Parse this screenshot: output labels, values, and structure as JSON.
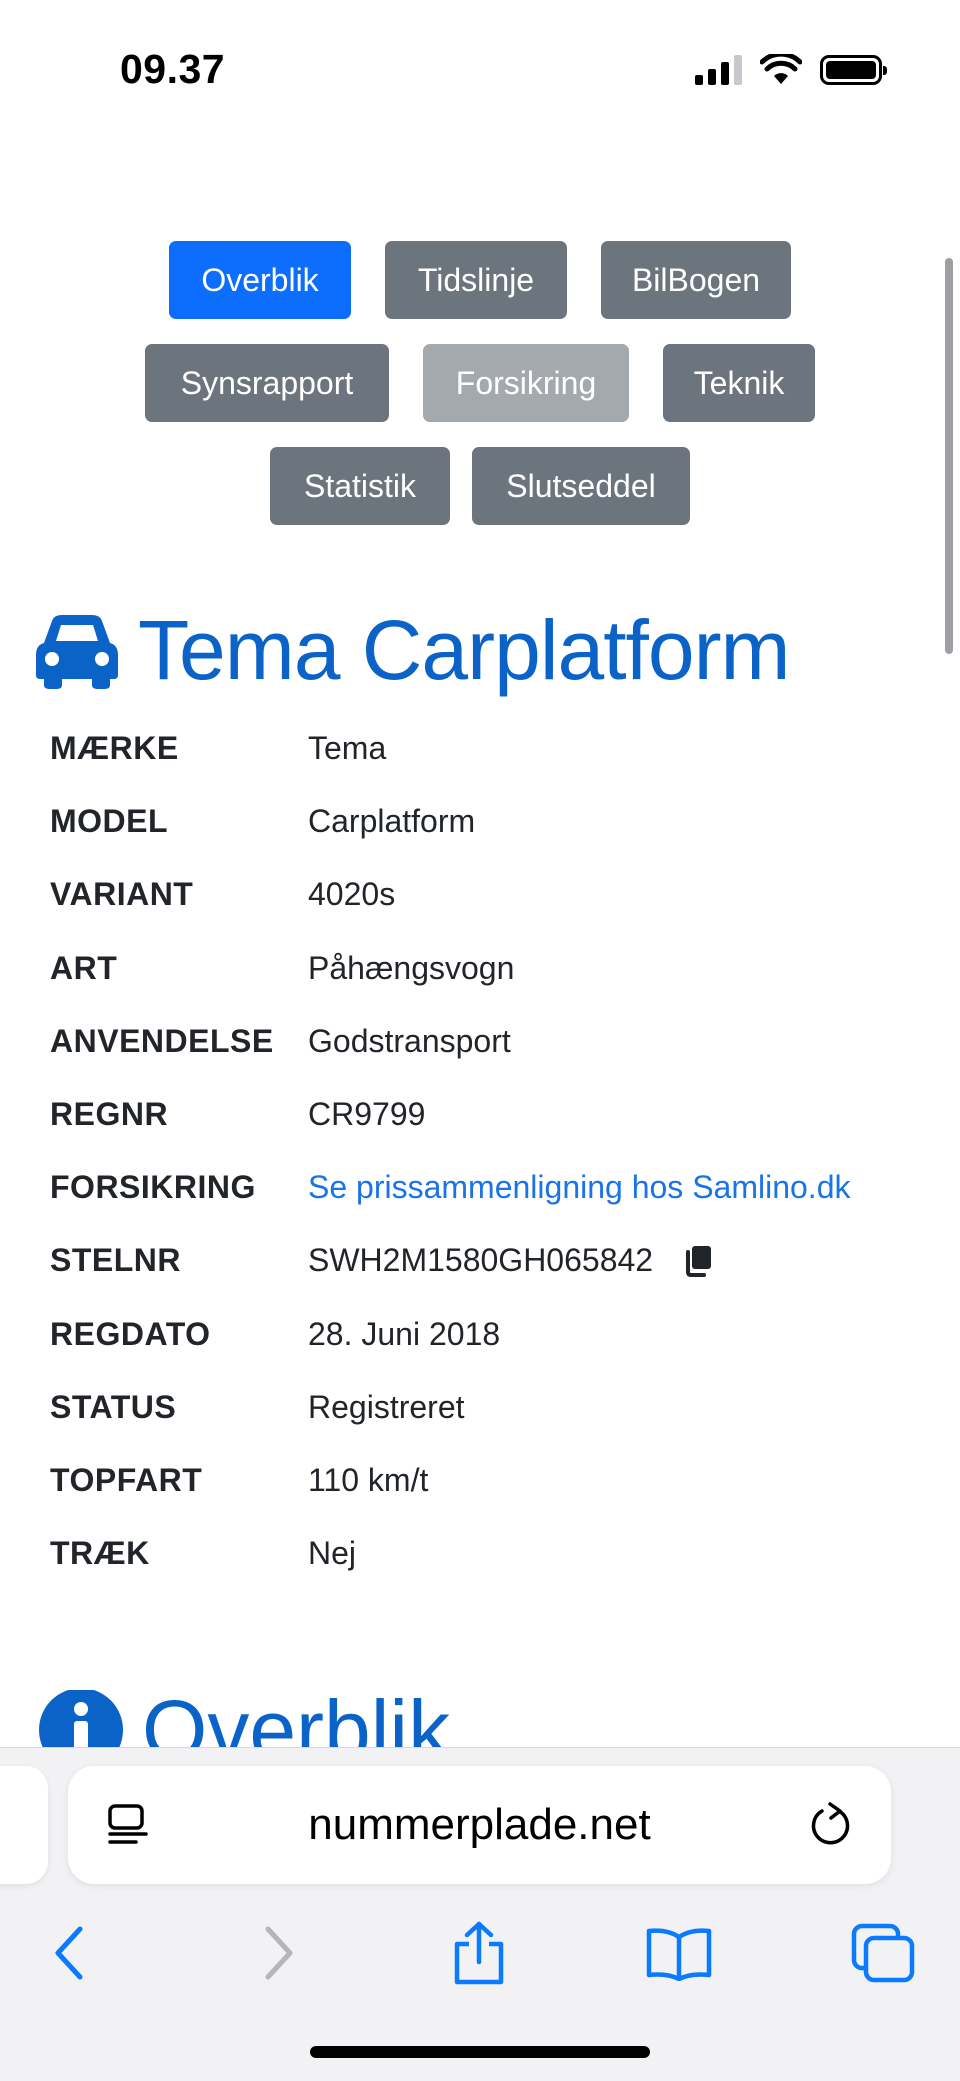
{
  "status_bar": {
    "time": "09.37"
  },
  "nav": {
    "row1": [
      "Overblik",
      "Tidslinje",
      "BilBogen"
    ],
    "row2": [
      "Synsrapport",
      "Forsikring",
      "Teknik"
    ],
    "row3": [
      "Statistik",
      "Slutseddel"
    ]
  },
  "vehicle": {
    "title": "Tema Carplatform",
    "rows": [
      {
        "label": "MÆRKE",
        "value": "Tema"
      },
      {
        "label": "MODEL",
        "value": "Carplatform"
      },
      {
        "label": "VARIANT",
        "value": "4020s"
      },
      {
        "label": "ART",
        "value": "Påhængsvogn"
      },
      {
        "label": "ANVENDELSE",
        "value": "Godstransport"
      },
      {
        "label": "REGNR",
        "value": "CR9799"
      },
      {
        "label": "FORSIKRING",
        "value": "Se prissammenligning hos Samlino.dk"
      },
      {
        "label": "STELNR",
        "value": "SWH2M1580GH065842"
      },
      {
        "label": "REGDATO",
        "value": "28. Juni 2018"
      },
      {
        "label": "STATUS",
        "value": "Registreret"
      },
      {
        "label": "TOPFART",
        "value": "110 km/t"
      },
      {
        "label": "TRÆK",
        "value": "Nej"
      }
    ]
  },
  "section": {
    "title": "Overblik"
  },
  "browser": {
    "url": "nummerplade.net"
  },
  "colors": {
    "primary": "#0d6efd",
    "secondary": "#6c757d",
    "heading": "#0b63c7",
    "link": "#1a73e8",
    "ios_blue": "#0a7aff"
  },
  "icons": {
    "vehicle": "car-icon",
    "section": "info-icon",
    "copy": "copy-icon"
  }
}
